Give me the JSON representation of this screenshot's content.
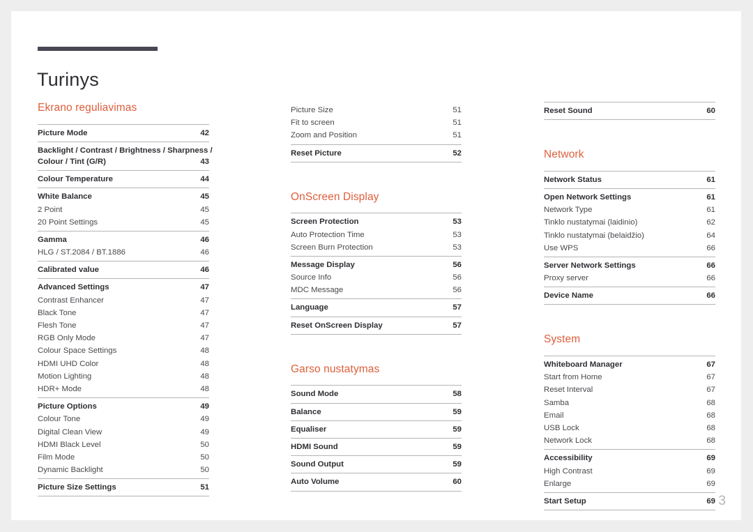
{
  "document": {
    "title": "Turinys",
    "page_number": "3",
    "accent_color": "#dd5f3c",
    "rule_color": "#4a4754"
  },
  "columns": [
    {
      "name": "column-left",
      "blocks": [
        {
          "type": "section",
          "heading": "Ekrano reguliavimas",
          "groups": [
            {
              "entries": [
                {
                  "label": "Picture Mode",
                  "page": "42",
                  "level": "top"
                }
              ]
            },
            {
              "entries": [
                {
                  "label": "Backlight / Contrast / Brightness / Sharpness / Colour / Tint (G/R)",
                  "page": "43",
                  "level": "top",
                  "wrap": true
                }
              ]
            },
            {
              "entries": [
                {
                  "label": "Colour Temperature",
                  "page": "44",
                  "level": "top"
                }
              ]
            },
            {
              "entries": [
                {
                  "label": "White Balance",
                  "page": "45",
                  "level": "top"
                },
                {
                  "label": "2 Point",
                  "page": "45",
                  "level": "sub"
                },
                {
                  "label": "20 Point Settings",
                  "page": "45",
                  "level": "sub"
                }
              ]
            },
            {
              "entries": [
                {
                  "label": "Gamma",
                  "page": "46",
                  "level": "top"
                },
                {
                  "label": "HLG / ST.2084 / BT.1886",
                  "page": "46",
                  "level": "sub"
                }
              ]
            },
            {
              "entries": [
                {
                  "label": "Calibrated value",
                  "page": "46",
                  "level": "top"
                }
              ]
            },
            {
              "entries": [
                {
                  "label": "Advanced Settings",
                  "page": "47",
                  "level": "top"
                },
                {
                  "label": "Contrast Enhancer",
                  "page": "47",
                  "level": "sub"
                },
                {
                  "label": "Black Tone",
                  "page": "47",
                  "level": "sub"
                },
                {
                  "label": "Flesh Tone",
                  "page": "47",
                  "level": "sub"
                },
                {
                  "label": "RGB Only Mode",
                  "page": "47",
                  "level": "sub"
                },
                {
                  "label": "Colour Space Settings",
                  "page": "48",
                  "level": "sub"
                },
                {
                  "label": "HDMI UHD Color",
                  "page": "48",
                  "level": "sub"
                },
                {
                  "label": "Motion Lighting",
                  "page": "48",
                  "level": "sub"
                },
                {
                  "label": "HDR+ Mode",
                  "page": "48",
                  "level": "sub"
                }
              ]
            },
            {
              "entries": [
                {
                  "label": "Picture Options",
                  "page": "49",
                  "level": "top"
                },
                {
                  "label": "Colour Tone",
                  "page": "49",
                  "level": "sub"
                },
                {
                  "label": "Digital Clean View",
                  "page": "49",
                  "level": "sub"
                },
                {
                  "label": "HDMI Black Level",
                  "page": "50",
                  "level": "sub"
                },
                {
                  "label": "Film Mode",
                  "page": "50",
                  "level": "sub"
                },
                {
                  "label": "Dynamic Backlight",
                  "page": "50",
                  "level": "sub"
                }
              ]
            },
            {
              "entries": [
                {
                  "label": "Picture Size Settings",
                  "page": "51",
                  "level": "top"
                }
              ]
            }
          ]
        }
      ]
    },
    {
      "name": "column-middle",
      "blocks": [
        {
          "type": "continuation",
          "heading": "",
          "groups": [
            {
              "no_rule": true,
              "entries": [
                {
                  "label": "Picture Size",
                  "page": "51",
                  "level": "sub"
                },
                {
                  "label": "Fit to screen",
                  "page": "51",
                  "level": "sub"
                },
                {
                  "label": "Zoom and Position",
                  "page": "51",
                  "level": "sub"
                }
              ]
            },
            {
              "entries": [
                {
                  "label": "Reset Picture",
                  "page": "52",
                  "level": "top"
                }
              ]
            }
          ]
        },
        {
          "type": "section",
          "heading": "OnScreen Display",
          "groups": [
            {
              "entries": [
                {
                  "label": "Screen Protection",
                  "page": "53",
                  "level": "top"
                },
                {
                  "label": "Auto Protection Time",
                  "page": "53",
                  "level": "sub"
                },
                {
                  "label": "Screen Burn Protection",
                  "page": "53",
                  "level": "sub"
                }
              ]
            },
            {
              "entries": [
                {
                  "label": "Message Display",
                  "page": "56",
                  "level": "top"
                },
                {
                  "label": "Source Info",
                  "page": "56",
                  "level": "sub"
                },
                {
                  "label": "MDC Message",
                  "page": "56",
                  "level": "sub"
                }
              ]
            },
            {
              "entries": [
                {
                  "label": "Language",
                  "page": "57",
                  "level": "top"
                }
              ]
            },
            {
              "entries": [
                {
                  "label": "Reset OnScreen Display",
                  "page": "57",
                  "level": "top"
                }
              ]
            }
          ]
        },
        {
          "type": "section",
          "heading": "Garso nustatymas",
          "groups": [
            {
              "entries": [
                {
                  "label": "Sound Mode",
                  "page": "58",
                  "level": "top"
                }
              ]
            },
            {
              "entries": [
                {
                  "label": "Balance",
                  "page": "59",
                  "level": "top"
                }
              ]
            },
            {
              "entries": [
                {
                  "label": "Equaliser",
                  "page": "59",
                  "level": "top"
                }
              ]
            },
            {
              "entries": [
                {
                  "label": "HDMI Sound",
                  "page": "59",
                  "level": "top"
                }
              ]
            },
            {
              "entries": [
                {
                  "label": "Sound Output",
                  "page": "59",
                  "level": "top"
                }
              ]
            },
            {
              "entries": [
                {
                  "label": "Auto Volume",
                  "page": "60",
                  "level": "top"
                }
              ]
            }
          ]
        }
      ]
    },
    {
      "name": "column-right",
      "blocks": [
        {
          "type": "continuation",
          "heading": "",
          "groups": [
            {
              "entries": [
                {
                  "label": "Reset Sound",
                  "page": "60",
                  "level": "top"
                }
              ]
            }
          ]
        },
        {
          "type": "section",
          "heading": "Network",
          "groups": [
            {
              "entries": [
                {
                  "label": "Network Status",
                  "page": "61",
                  "level": "top"
                }
              ]
            },
            {
              "entries": [
                {
                  "label": "Open Network Settings",
                  "page": "61",
                  "level": "top"
                },
                {
                  "label": "Network Type",
                  "page": "61",
                  "level": "sub"
                },
                {
                  "label": "Tinklo nustatymai (laidinio)",
                  "page": "62",
                  "level": "sub"
                },
                {
                  "label": "Tinklo nustatymai (belaidžio)",
                  "page": "64",
                  "level": "sub"
                },
                {
                  "label": "Use WPS",
                  "page": "66",
                  "level": "sub"
                }
              ]
            },
            {
              "entries": [
                {
                  "label": "Server Network Settings",
                  "page": "66",
                  "level": "top"
                },
                {
                  "label": "Proxy server",
                  "page": "66",
                  "level": "sub"
                }
              ]
            },
            {
              "entries": [
                {
                  "label": "Device Name",
                  "page": "66",
                  "level": "top"
                }
              ]
            }
          ]
        },
        {
          "type": "section",
          "heading": "System",
          "groups": [
            {
              "entries": [
                {
                  "label": "Whiteboard Manager",
                  "page": "67",
                  "level": "top"
                },
                {
                  "label": "Start from Home",
                  "page": "67",
                  "level": "sub"
                },
                {
                  "label": "Reset Interval",
                  "page": "67",
                  "level": "sub"
                },
                {
                  "label": "Samba",
                  "page": "68",
                  "level": "sub"
                },
                {
                  "label": "Email",
                  "page": "68",
                  "level": "sub"
                },
                {
                  "label": "USB Lock",
                  "page": "68",
                  "level": "sub"
                },
                {
                  "label": "Network Lock",
                  "page": "68",
                  "level": "sub"
                }
              ]
            },
            {
              "entries": [
                {
                  "label": "Accessibility",
                  "page": "69",
                  "level": "top"
                },
                {
                  "label": "High Contrast",
                  "page": "69",
                  "level": "sub"
                },
                {
                  "label": "Enlarge",
                  "page": "69",
                  "level": "sub"
                }
              ]
            },
            {
              "entries": [
                {
                  "label": "Start Setup",
                  "page": "69",
                  "level": "top"
                }
              ]
            }
          ]
        }
      ]
    }
  ]
}
